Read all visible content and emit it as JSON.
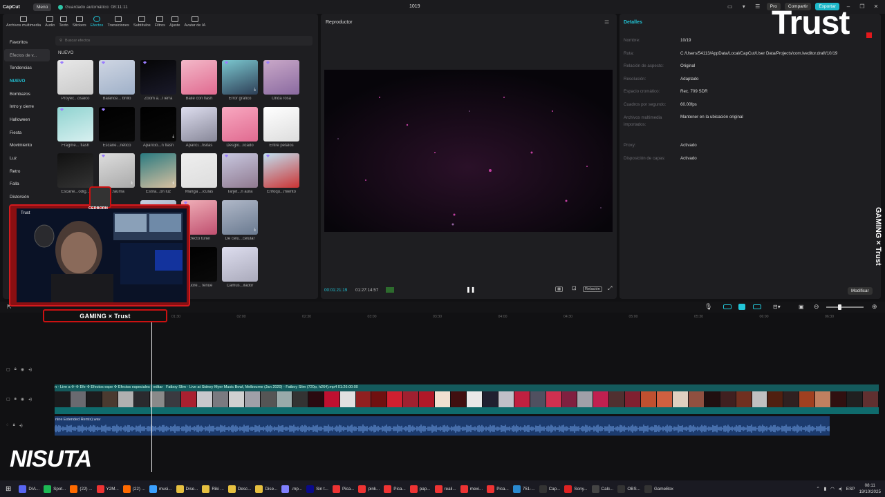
{
  "titlebar": {
    "app_name": "CapCut",
    "menu": "Menú",
    "autosave": "Guardado automático: 08:11:11",
    "project": "1019",
    "pro": "Pro",
    "share": "Compartir",
    "export": "Exportar"
  },
  "tools": [
    "Archivos multimedia",
    "Audio",
    "Texto",
    "Stickers",
    "Efectos",
    "Transiciones",
    "Subtítulos",
    "Filtros",
    "Ajuste",
    "Avatar de IA"
  ],
  "categories": [
    "Favoritos",
    "Efectos de v...",
    "Tendencias",
    "NUEVO",
    "Bombazos",
    "Intro y cierre",
    "Halloween",
    "Fiesta",
    "Movimiento",
    "Luz",
    "Retro",
    "Falla",
    "Distorsión"
  ],
  "search_placeholder": "Buscar efectos",
  "section_title": "NUEVO",
  "effects": [
    "Proyec...osaico",
    "Balance... brillo",
    "Zoom a...Tierra",
    "Baile con flash",
    "Error gráfico",
    "Onda rosa",
    "Fragme... flash",
    "Escane...nético",
    "Aparició...n flash",
    "Aparici...fisitas",
    "Desglo...licado",
    "Entre pétalos",
    "Escane...odig...",
    "...fauma",
    "Estira...on luz",
    "Manga ...iculas",
    "Tarjet...n aura",
    "Enfoqu...miento",
    "",
    "",
    "...e rotación",
    "Efecto túnel",
    "De celu...celular",
    "",
    "",
    "",
    "...e p...trellas",
    "Fluore... tenue",
    "Camus...ilador",
    ""
  ],
  "player": {
    "title": "Reproductor",
    "time_current": "00:01:21:19",
    "time_total": "01:27:14:57",
    "ratio": "Relación"
  },
  "details": {
    "title": "Detalles",
    "rows": [
      {
        "k": "Nombre:",
        "v": "10/19"
      },
      {
        "k": "Ruta:",
        "v": "C:/Users/54113/AppData/Local/CapCut/User Data/Projects/com.lveditor.draft/10/19"
      },
      {
        "k": "Relación de aspecto:",
        "v": "Original"
      },
      {
        "k": "Resolución:",
        "v": "Adaptado"
      },
      {
        "k": "Espacio cromático:",
        "v": "Rec. 709 SDR"
      },
      {
        "k": "Cuadros por segundo:",
        "v": "60.00fps"
      },
      {
        "k": "Archivos multimedia importados:",
        "v": "Mantener en la ubicación original"
      },
      {
        "k": "Proxy:",
        "v": "Activado"
      },
      {
        "k": "Disposición de capas:",
        "v": "Activado"
      }
    ],
    "modify": "Modificar"
  },
  "ruler": [
    "01:30",
    "02:00",
    "02:30",
    "03:00",
    "03:30",
    "04:00",
    "04:30",
    "05:00",
    "05:30",
    "06:00",
    "06:30"
  ],
  "timeline": {
    "effect_chips": [
      "n - Live a",
      "Efe",
      "Efectos espe",
      "Efectos especiales - editar"
    ],
    "video_clip": "Fatboy Slim - Live at Sidney Myer Music Bowl, Melbourne (Jan 2020) - Fatboy Slim (720p, h264).mp4   01:26:00:00",
    "audio_clip": "nine Extended Remix).wav"
  },
  "overlay": {
    "cam_name": "Trust",
    "cam_badge": "CERBORN",
    "gaming_bar": "GAMING × Trust",
    "trust_logo": "Trust",
    "side_brand": "GAMING × Trust",
    "nisuta": "NISUTA"
  },
  "taskbar": {
    "items": [
      "DIA...",
      "Spot...",
      "(22) ...",
      "Y2M...",
      "(22) ...",
      "musi...",
      "Dise...",
      "Riki ...",
      "Desc...",
      "Dise...",
      ".mp...",
      "Sin t...",
      "Pica...",
      "pink...",
      "Pica...",
      "pap...",
      "reali...",
      "mexi...",
      "Pica...",
      "751-...",
      "Cap...",
      "Sony...",
      "Calc...",
      "OBS...",
      "GameBox"
    ],
    "lang": "ESP",
    "time": "08:11",
    "date": "19/10/2025"
  },
  "colors": {
    "accent": "#22c6d8",
    "brand_red": "#d41a1e",
    "track_teal": "#145a5c",
    "audio_blue": "#1c3b6e"
  }
}
